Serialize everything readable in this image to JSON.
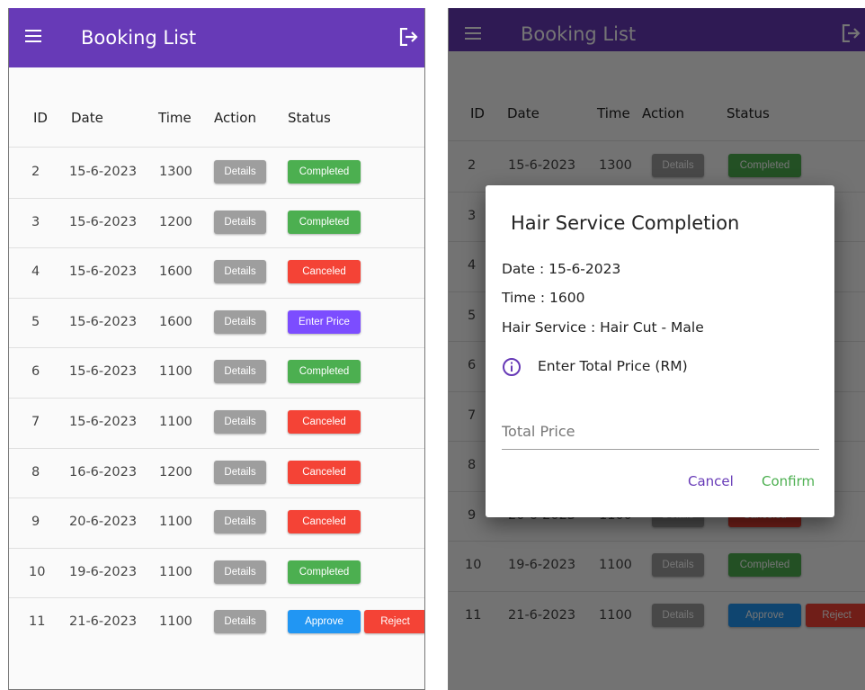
{
  "app": {
    "title": "Booking List",
    "menu_icon": "hamburger-menu-icon",
    "logout_icon": "logout-icon",
    "primary_color": "#673ab7"
  },
  "table": {
    "headers": [
      "ID",
      "Date",
      "Time",
      "Action",
      "Status"
    ],
    "rows": [
      {
        "id": "2",
        "date": "15-6-2023",
        "time": "1300",
        "action": "Details",
        "status": "Completed"
      },
      {
        "id": "3",
        "date": "15-6-2023",
        "time": "1200",
        "action": "Details",
        "status": "Completed"
      },
      {
        "id": "4",
        "date": "15-6-2023",
        "time": "1600",
        "action": "Details",
        "status": "Canceled"
      },
      {
        "id": "5",
        "date": "15-6-2023",
        "time": "1600",
        "action": "Details",
        "status": "Enter Price"
      },
      {
        "id": "6",
        "date": "15-6-2023",
        "time": "1100",
        "action": "Details",
        "status": "Completed"
      },
      {
        "id": "7",
        "date": "15-6-2023",
        "time": "1100",
        "action": "Details",
        "status": "Canceled"
      },
      {
        "id": "8",
        "date": "16-6-2023",
        "time": "1200",
        "action": "Details",
        "status": "Canceled"
      },
      {
        "id": "9",
        "date": "20-6-2023",
        "time": "1100",
        "action": "Details",
        "status": "Canceled"
      },
      {
        "id": "10",
        "date": "19-6-2023",
        "time": "1100",
        "action": "Details",
        "status": "Completed"
      },
      {
        "id": "11",
        "date": "21-6-2023",
        "time": "1100",
        "action": "Details",
        "status": "Approve",
        "secondary": "Reject"
      }
    ]
  },
  "status_colors": {
    "Completed": "#4caf50",
    "Canceled": "#f44336",
    "Enter Price": "#7c4dff",
    "Approve": "#2196f3",
    "Reject": "#f44336",
    "Details": "#9e9e9e"
  },
  "dialog": {
    "title": "Hair Service Completion",
    "date_line": "Date  : 15-6-2023",
    "time_line": "Time  : 1600",
    "service_line": "Hair Service  : Hair Cut - Male",
    "info_icon": "info-circle-icon",
    "info_text": "Enter Total Price (RM)",
    "price_placeholder": "Total Price",
    "cancel_label": "Cancel",
    "confirm_label": "Confirm"
  }
}
